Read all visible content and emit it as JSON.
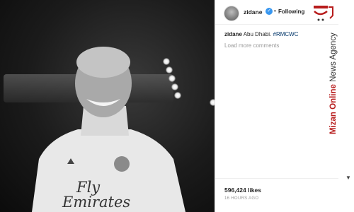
{
  "post": {
    "username": "zidane",
    "verified_mark": "✓",
    "separator": "•",
    "follow_status": "Following",
    "caption_user": "zidane",
    "caption_text": "Abu Dhabi. ",
    "caption_hashtag": "#RMCWC",
    "load_more": "Load more comments",
    "likes": "596,424 likes",
    "time_ago": "16 HOURS AGO",
    "shirt_sponsor_line1": "Fly",
    "shirt_sponsor_line2": "Emirates"
  },
  "watermark": {
    "brand_bold": "Mizan Online",
    "brand_rest": " News Agency",
    "logo_icon": "mizan-logo-icon"
  },
  "colors": {
    "link": "#003569",
    "verified": "#3897f0",
    "watermark_red": "#b71c1c"
  }
}
